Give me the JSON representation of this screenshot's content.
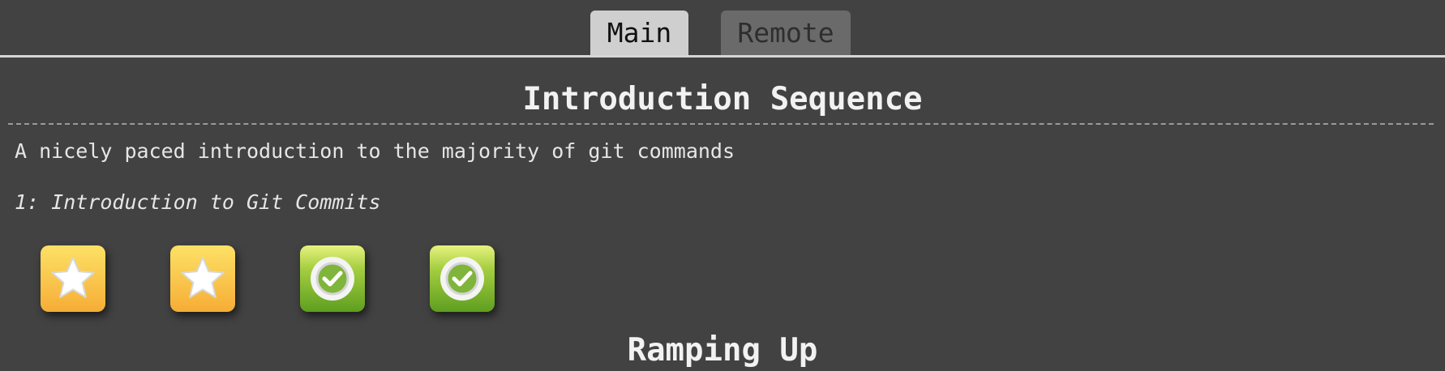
{
  "tabs": {
    "main": "Main",
    "remote": "Remote"
  },
  "sequence": {
    "title": "Introduction Sequence",
    "description": "A nicely paced introduction to the majority of git commands",
    "level_heading": "1: Introduction to Git Commits",
    "levels": [
      {
        "icon": "star-icon",
        "status": "not-solved"
      },
      {
        "icon": "star-icon",
        "status": "not-solved"
      },
      {
        "icon": "checkmark-icon",
        "status": "solved"
      },
      {
        "icon": "checkmark-icon",
        "status": "solved"
      }
    ]
  },
  "next_sequence": {
    "title": "Ramping Up"
  },
  "colors": {
    "background": "#424242",
    "tab_active": "#cfcfcf",
    "tab_inactive": "#6a6a6a",
    "star_gradient_top": "#fde166",
    "star_gradient_bottom": "#f6ad36",
    "done_gradient_top": "#e6f27e",
    "done_gradient_bottom": "#5e9e1f"
  }
}
